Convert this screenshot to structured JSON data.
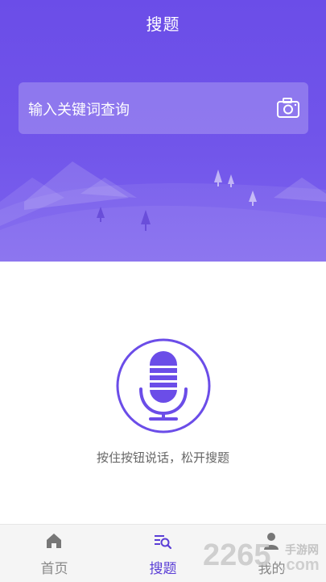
{
  "header": {
    "title": "搜题"
  },
  "search": {
    "placeholder": "输入关键词查询"
  },
  "voice": {
    "hint": "按住按钮说话，松开搜题"
  },
  "tabs": [
    {
      "label": "首页",
      "icon": "home-icon",
      "active": false
    },
    {
      "label": "搜题",
      "icon": "search-list-icon",
      "active": true
    },
    {
      "label": "我的",
      "icon": "user-icon",
      "active": false
    }
  ],
  "watermark": {
    "brand": "2265",
    "suffix": ".com",
    "tagline": "手游网"
  },
  "colors": {
    "primary": "#6b4de8",
    "active_tab": "#5b3fd6"
  }
}
